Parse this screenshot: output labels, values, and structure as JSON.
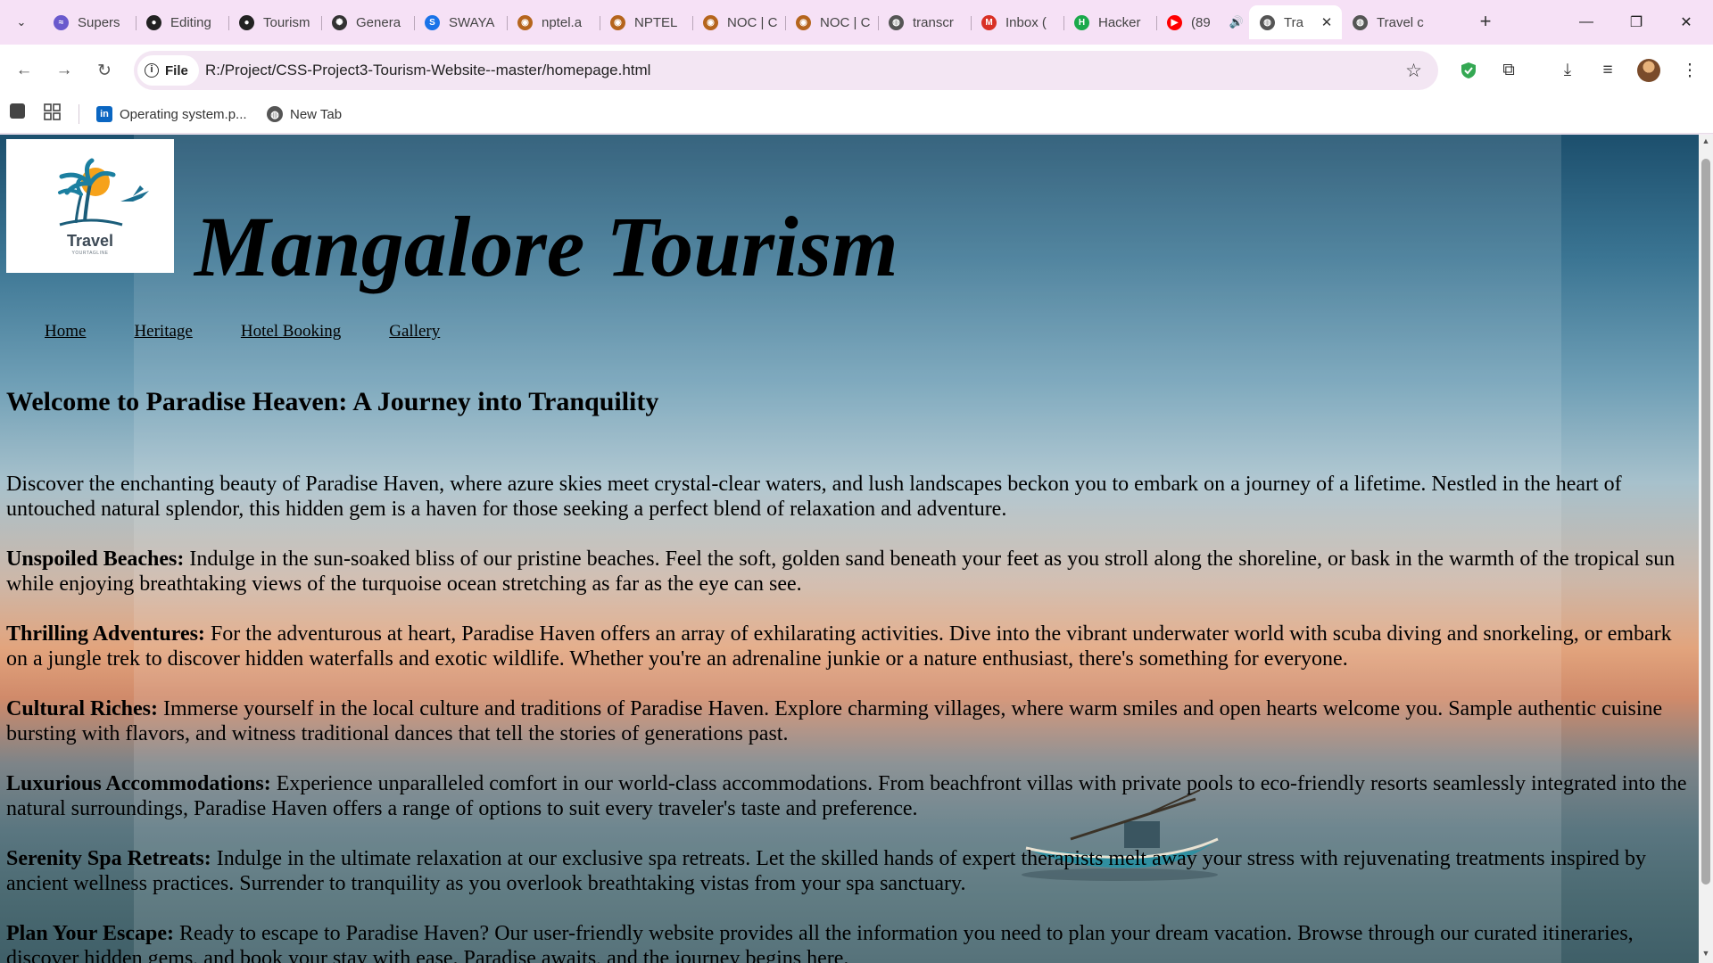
{
  "browser": {
    "tabs": [
      {
        "title": "Supers",
        "icon": "supersonic-icon",
        "color": "#6a5acd",
        "glyph": "≈"
      },
      {
        "title": "Editing",
        "icon": "github-icon",
        "color": "#222222",
        "glyph": "●"
      },
      {
        "title": "Tourism",
        "icon": "github-icon",
        "color": "#222222",
        "glyph": "●"
      },
      {
        "title": "Genera",
        "icon": "chatgpt-icon",
        "color": "#333333",
        "glyph": "✺"
      },
      {
        "title": "SWAYA",
        "icon": "swayam-icon",
        "color": "#1a73e8",
        "glyph": "S"
      },
      {
        "title": "nptel.a",
        "icon": "nptel-icon",
        "color": "#b5651d",
        "glyph": "◉"
      },
      {
        "title": "NPTEL",
        "icon": "nptel-icon",
        "color": "#b5651d",
        "glyph": "◉"
      },
      {
        "title": "NOC | C",
        "icon": "nptel-icon",
        "color": "#b5651d",
        "glyph": "◉"
      },
      {
        "title": "NOC | C",
        "icon": "nptel-icon",
        "color": "#b5651d",
        "glyph": "◉"
      },
      {
        "title": "transcr",
        "icon": "globe-icon",
        "color": "#555555",
        "glyph": "◍"
      },
      {
        "title": "Inbox (",
        "icon": "gmail-icon",
        "color": "#d93025",
        "glyph": "M"
      },
      {
        "title": "Hacker",
        "icon": "hackerrank-icon",
        "color": "#1ba94c",
        "glyph": "H"
      },
      {
        "title": "(89",
        "icon": "youtube-icon",
        "color": "#ff0000",
        "glyph": "▶",
        "audio": true
      },
      {
        "title": "Tra",
        "icon": "globe-icon",
        "color": "#555555",
        "glyph": "◍",
        "active": true
      },
      {
        "title": "Travel c",
        "icon": "globe-icon",
        "color": "#555555",
        "glyph": "◍"
      }
    ],
    "new_tab": "+",
    "url_chip": "File",
    "url": "R:/Project/CSS-Project3-Tourism-Website--master/homepage.html",
    "bookmarks": [
      {
        "label": "Operating system.p...",
        "icon": "linkedin-icon",
        "color": "#0a66c2",
        "glyph": "in"
      },
      {
        "label": "New Tab",
        "icon": "globe-icon",
        "color": "#555555",
        "glyph": "◍"
      }
    ]
  },
  "site": {
    "logo_text": "Travel",
    "logo_sub": "YOURTAGLINE",
    "title": "Mangalore Tourism",
    "nav": [
      "Home",
      "Heritage",
      "Hotel Booking",
      "Gallery"
    ],
    "welcome": "Welcome to Paradise Heaven: A Journey into Tranquility",
    "intro": "Discover the enchanting beauty of Paradise Haven, where azure skies meet crystal-clear waters, and lush landscapes beckon you to embark on a journey of a lifetime. Nestled in the heart of untouched natural splendor, this hidden gem is a haven for those seeking a perfect blend of relaxation and adventure.",
    "sections": [
      {
        "heading": "Unspoiled Beaches:",
        "text": " Indulge in the sun-soaked bliss of our pristine beaches. Feel the soft, golden sand beneath your feet as you stroll along the shoreline, or bask in the warmth of the tropical sun while enjoying breathtaking views of the turquoise ocean stretching as far as the eye can see."
      },
      {
        "heading": "Thrilling Adventures:",
        "text": " For the adventurous at heart, Paradise Haven offers an array of exhilarating activities. Dive into the vibrant underwater world with scuba diving and snorkeling, or embark on a jungle trek to discover hidden waterfalls and exotic wildlife. Whether you're an adrenaline junkie or a nature enthusiast, there's something for everyone."
      },
      {
        "heading": "Cultural Riches:",
        "text": " Immerse yourself in the local culture and traditions of Paradise Haven. Explore charming villages, where warm smiles and open hearts welcome you. Sample authentic cuisine bursting with flavors, and witness traditional dances that tell the stories of generations past."
      },
      {
        "heading": "Luxurious Accommodations:",
        "text": " Experience unparalleled comfort in our world-class accommodations. From beachfront villas with private pools to eco-friendly resorts seamlessly integrated into the natural surroundings, Paradise Haven offers a range of options to suit every traveler's taste and preference."
      },
      {
        "heading": "Serenity Spa Retreats:",
        "text": " Indulge in the ultimate relaxation at our exclusive spa retreats. Let the skilled hands of expert therapists melt away your stress with rejuvenating treatments inspired by ancient wellness practices. Surrender to tranquility as you overlook breathtaking vistas from your spa sanctuary."
      },
      {
        "heading": "Plan Your Escape:",
        "text": " Ready to escape to Paradise Haven? Our user-friendly website provides all the information you need to plan your dream vacation. Browse through our curated itineraries, discover hidden gems, and book your stay with ease. Paradise awaits, and the journey begins here."
      }
    ]
  }
}
